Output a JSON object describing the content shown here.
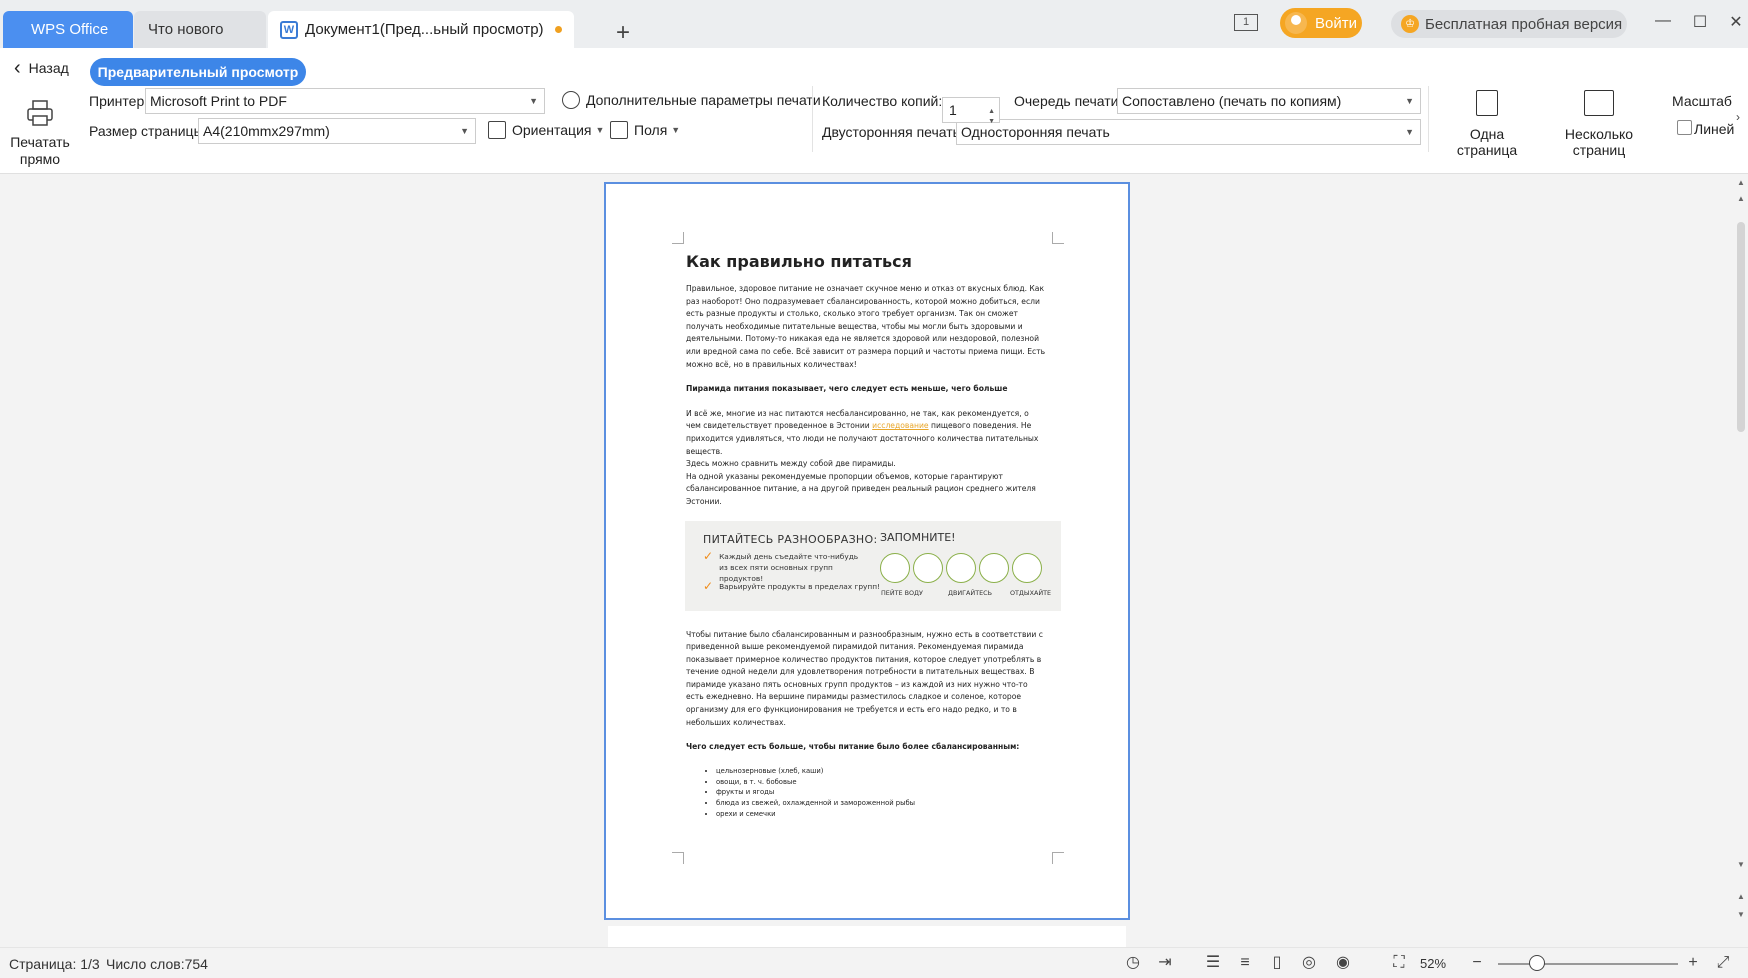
{
  "tabs": {
    "app": "WPS Office",
    "whats_new": "Что нового",
    "document": "Документ1(Пред...ьный просмотр)",
    "plus": "+"
  },
  "titlebar": {
    "window_count": "1",
    "login": "Войти",
    "trial": "Бесплатная пробная версия",
    "crown": "♔",
    "minimize": "—",
    "maximize": "☐",
    "close": "✕"
  },
  "toolbar": {
    "back": "Назад",
    "preview": "Предварительный просмотр",
    "print_now": "Печатать прямо",
    "printer_label": "Принтер:",
    "printer_value": "Microsoft Print to PDF",
    "page_size_label": "Размер страницы:",
    "page_size_value": "A4(210mmx297mm)",
    "more_params": "Дополнительные параметры печати",
    "orientation": "Ориентация",
    "margins": "Поля",
    "copies_label": "Количество копий:",
    "copies_value": "1",
    "queue_label": "Очередь печати:",
    "queue_value": "Сопоставлено (печать по копиям)",
    "duplex_label": "Двусторонняя печать:",
    "duplex_value": "Односторонняя печать",
    "one_page": "Одна страница",
    "multi_page": "Несколько страниц",
    "scale": "Масштаб",
    "lines": "Линей"
  },
  "document": {
    "title": "Как правильно питаться",
    "p1": "Правильное, здоровое питание не означает скучное меню и отказ от вкусных блюд. Как раз наоборот! Оно подразумевает сбалансированность, которой можно добиться, если есть разные продукты и столько, сколько этого требует организм. Так он сможет получать необходимые питательные вещества, чтобы мы могли быть здоровыми и деятельными. Потому-то никакая еда не является здоровой или нездоровой, полезной или вредной сама по себе. Всё зависит от размера порций и частоты приема пищи. Есть можно всё, но в правильных количествах!",
    "h2": "Пирамида питания показывает, чего следует есть меньше, чего больше",
    "p2a": "И всё же, многие из нас питаются несбалансированно, не так, как рекомендуется, о чем свидетельствует проведенное в Эстонии ",
    "p2link": "исследование",
    "p2b": " пищевого поведения. Не приходится удивляться, что люди не получают достаточного количества питательных веществ.",
    "p2c": "Здесь можно сравнить между собой две пирамиды.",
    "p2d": "На одной указаны рекомендуемые пропорции объемов, которые гарантируют сбалансированное питание, а на другой приведен реальный рацион среднего жителя Эстонии.",
    "banner": {
      "heading_left": "ПИТАЙТЕСЬ РАЗНООБРАЗНО:",
      "heading_right": "ЗАПОМНИТЕ!",
      "item1": "Каждый день съедайте что-нибудь из всех пяти основных групп продуктов!",
      "item2": "Варьируйте продукты в пределах групп!",
      "check": "✓",
      "tip1": "ПЕЙТЕ ВОДУ",
      "tip2": "ДВИГАЙТЕСЬ",
      "tip3": "ОТДЫХАЙТЕ"
    },
    "p3": "Чтобы питание было сбалансированным и разнообразным, нужно есть в соответствии с приведенной выше рекомендуемой пирамидой питания. Рекомендуемая пирамида показывает примерное количество продуктов питания, которое следует употреблять в течение одной недели для удовлетворения потребности в питательных веществах. В пирамиде указано пять основных групп продуктов – из каждой из них нужно что-то есть ежедневно. На вершине пирамиды разместилось сладкое и соленое, которое организму для его функционирования не требуется и есть его надо редко, и то в небольших количествах.",
    "h3": "Чего следует есть больше, чтобы питание было более сбалансированным:",
    "list": [
      "цельнозерновые (хлеб, каши)",
      "овощи, в т. ч. бобовые",
      "фрукты и ягоды",
      "блюда из свежей, охлажденной и замороженной рыбы",
      "орехи и семечки"
    ]
  },
  "status": {
    "page": "Страница: 1/3",
    "words": "Число слов:754",
    "zoom": "52%",
    "zoom_level": 0.2
  },
  "colors": {
    "accent": "#3d86e8",
    "login": "#f5a623",
    "page_border": "#5b8fe0"
  }
}
